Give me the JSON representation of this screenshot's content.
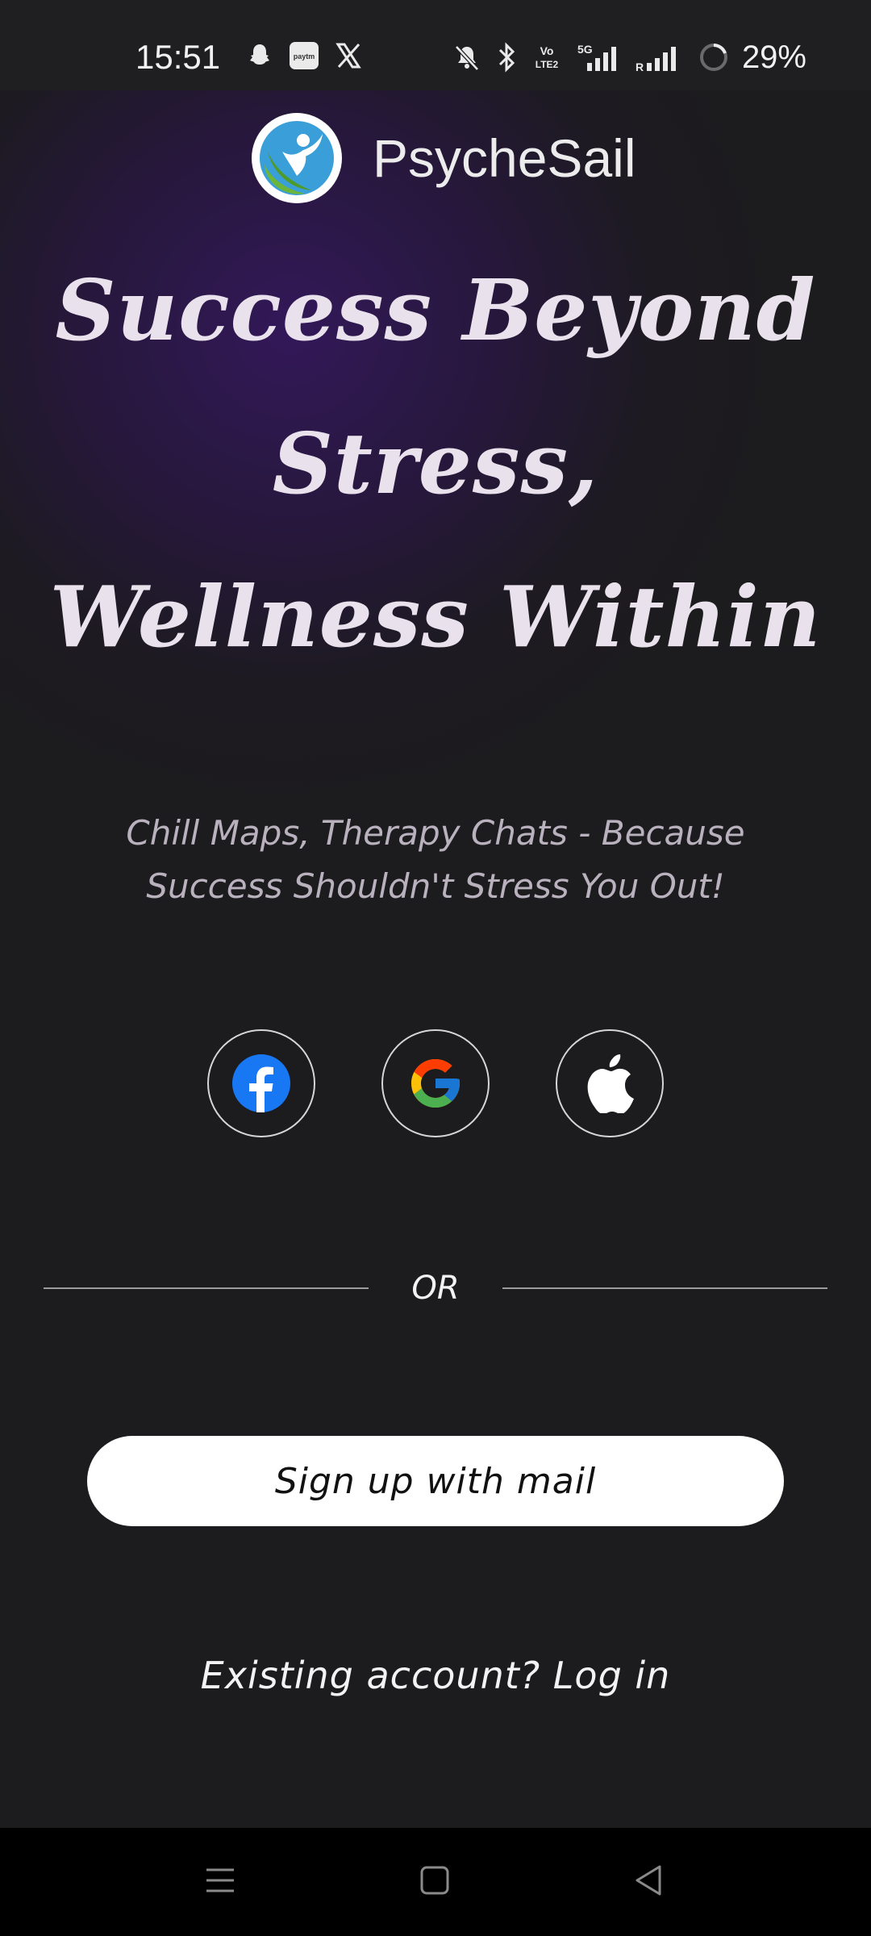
{
  "status_bar": {
    "time": "15:51",
    "battery": "29%",
    "left_icons": [
      "snapchat-icon",
      "paytm-icon",
      "x-icon"
    ],
    "paytm_text": "paytm",
    "right_icons": [
      "mute-icon",
      "bluetooth-icon",
      "volte-icon",
      "signal-5g-icon",
      "signal-roaming-icon",
      "battery-ring-icon"
    ],
    "volte_text": [
      "Vo",
      "LTE2"
    ],
    "net_text": "5G",
    "roaming_text": "R"
  },
  "brand": {
    "name": "PsycheSail",
    "logo_icon": "psychesail-logo-icon"
  },
  "hero": {
    "line1": "Success Beyond",
    "line2": "Stress,",
    "line3": "Wellness Within",
    "subtitle": "Chill Maps, Therapy Chats - Because Success Shouldn't Stress You Out!"
  },
  "social": {
    "facebook_icon": "facebook-icon",
    "google_icon": "google-icon",
    "apple_icon": "apple-icon"
  },
  "divider_text": "OR",
  "buttons": {
    "signup": "Sign up with mail",
    "login": "Existing account? Log in"
  },
  "nav": {
    "items": [
      "menu-icon",
      "home-icon",
      "back-icon"
    ]
  },
  "colors": {
    "background": "#1c1b1d",
    "glow": "#34185c",
    "headline": "#e9e2ec",
    "subtitle": "#b9b2be",
    "button_bg": "#ffffff",
    "facebook": "#1877f2"
  }
}
